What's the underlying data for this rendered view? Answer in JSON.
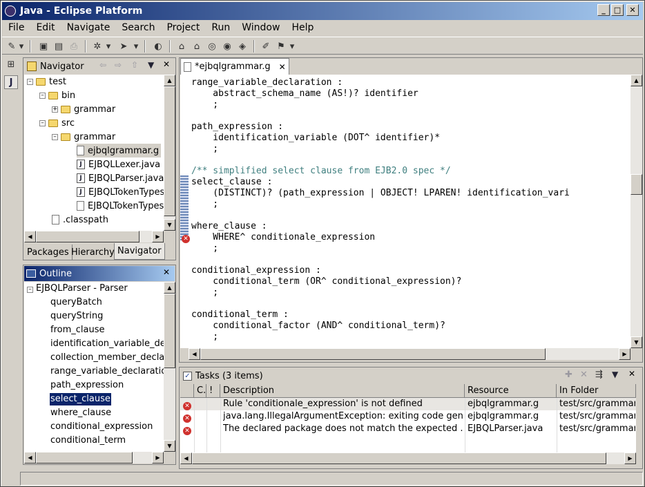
{
  "window": {
    "title": "Java - Eclipse Platform"
  },
  "menu": [
    "File",
    "Edit",
    "Navigate",
    "Search",
    "Project",
    "Run",
    "Window",
    "Help"
  ],
  "navigator": {
    "title": "Navigator",
    "tree": [
      "test",
      "bin",
      "grammar",
      "src",
      "grammar",
      "ejbqlgrammar.g",
      "EJBQLLexer.java",
      "EJBQLParser.java",
      "EJBQLTokenTypes",
      "EJBQLTokenTypes",
      ".classpath"
    ],
    "tabs": [
      "Packages",
      "Hierarchy",
      "Navigator"
    ]
  },
  "outline": {
    "title": "Outline",
    "root": "EJBQLParser - Parser",
    "items": [
      "queryBatch",
      "queryString",
      "from_clause",
      "identification_variable_decl",
      "collection_member_declar",
      "range_variable_declaration",
      "path_expression",
      "select_clause",
      "where_clause",
      "conditional_expression",
      "conditional_term"
    ],
    "selected": "select_clause"
  },
  "editor": {
    "tab": "*ejbqlgrammar.g",
    "lines": [
      "range_variable_declaration :",
      "    abstract_schema_name (AS!)? identifier",
      "    ;",
      "",
      "path_expression :",
      "    identification_variable (DOT^ identifier)*",
      "    ;",
      "",
      "/** simplified select clause from EJB2.0 spec */",
      "select_clause :",
      "    (DISTINCT)? (path_expression | OBJECT! LPAREN! identification_vari",
      "    ;",
      "",
      "where_clause :",
      "    WHERE^ conditionale_expression",
      "    ;",
      "",
      "conditional_expression :",
      "    conditional_term (OR^ conditional_expression)?",
      "    ;",
      "",
      "conditional_term :",
      "    conditional_factor (AND^ conditional_term)?",
      "    ;"
    ]
  },
  "tasks": {
    "title": "Tasks (3 items)",
    "columns": [
      "C.",
      "!",
      "Description",
      "Resource",
      "In Folder"
    ],
    "rows": [
      {
        "description": "Rule 'conditionale_expression' is not defined",
        "resource": "ejbqlgrammar.g",
        "folder": "test/src/grammar"
      },
      {
        "description": "java.lang.IllegalArgumentException: exiting code gen...",
        "resource": "ejbqlgrammar.g",
        "folder": "test/src/grammar"
      },
      {
        "description": "The declared package does not match the expected ...",
        "resource": "EJBQLParser.java",
        "folder": "test/src/grammar"
      }
    ]
  },
  "colors": {
    "title_start": "#0a246a",
    "title_end": "#a6caf0",
    "selection": "#0a246a",
    "comment": "#3f7f7f",
    "error": "#d0312d"
  }
}
